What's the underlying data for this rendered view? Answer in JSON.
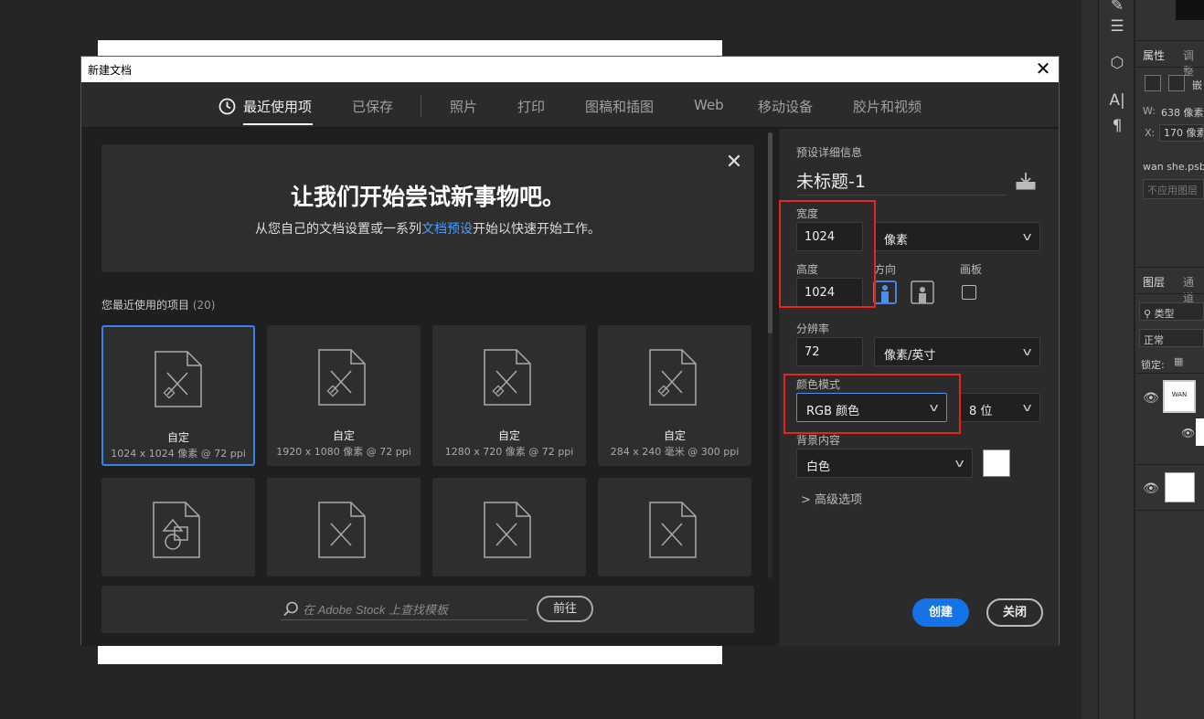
{
  "dialog": {
    "title": "新建文档",
    "close_glyph": "✕"
  },
  "tabs": [
    {
      "label": "最近使用项",
      "active": true
    },
    {
      "label": "已保存"
    },
    {
      "label": "照片"
    },
    {
      "label": "打印"
    },
    {
      "label": "图稿和插图"
    },
    {
      "label": "Web"
    },
    {
      "label": "移动设备"
    },
    {
      "label": "胶片和视频"
    }
  ],
  "welcome": {
    "title": "让我们开始尝试新事物吧。",
    "sub_before": "从您自己的文档设置或一系列",
    "sub_link": "文档预设",
    "sub_after": "开始以快速开始工作。",
    "close_glyph": "✕"
  },
  "recent": {
    "label": "您最近使用的项目",
    "count": "(20)",
    "cards": [
      {
        "name": "自定",
        "size": "1024 x 1024 像素 @ 72 ppi"
      },
      {
        "name": "自定",
        "size": "1920 x 1080 像素 @ 72 ppi"
      },
      {
        "name": "自定",
        "size": "1280 x 720 像素 @ 72 ppi"
      },
      {
        "name": "自定",
        "size": "284 x 240 毫米 @ 300 ppi"
      }
    ]
  },
  "stock": {
    "placeholder": "在 Adobe Stock 上查找模板",
    "go_label": "前往"
  },
  "details": {
    "section_label": "预设详细信息",
    "preset_name": "未标题-1",
    "width_label": "宽度",
    "width_value": "1024",
    "unit": "像素",
    "height_label": "高度",
    "height_value": "1024",
    "orientation_label": "方向",
    "artboard_label": "画板",
    "resolution_label": "分辨率",
    "resolution_value": "72",
    "resolution_unit": "像素/英寸",
    "color_mode_label": "颜色模式",
    "color_mode": "RGB 颜色",
    "bit_depth": "8 位",
    "background_label": "背景内容",
    "background": "白色",
    "advanced_label": "高级选项",
    "create_label": "创建",
    "close_label": "关闭"
  },
  "side_panel": {
    "props_tab": "属性",
    "adjust_tab": "调整",
    "props_row_label": "嵌",
    "w_label": "W:",
    "w_value": "638 像素",
    "x_label": "X:",
    "x_value": "170 像素",
    "file_name": "wan she.psb",
    "apply_layer_btn": "不应用图层",
    "layers_tab": "图层",
    "channels_tab": "通道",
    "filter_type": "类型",
    "blend_mode": "正常",
    "lock_label": "锁定:",
    "layer_thumb_text": "WAN"
  }
}
